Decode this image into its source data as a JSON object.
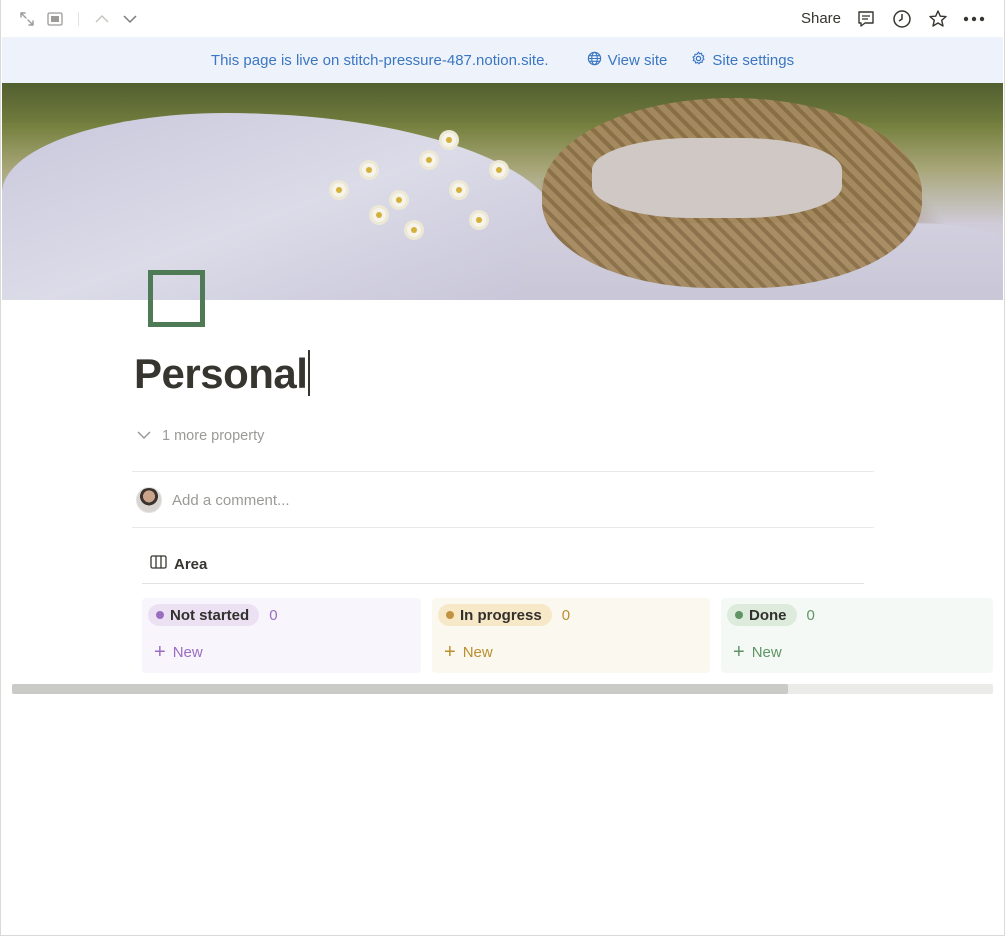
{
  "topbar": {
    "share_label": "Share",
    "left_icons": [
      "expand-icon",
      "peek-mode-icon",
      "chevron-up-icon",
      "chevron-down-icon"
    ],
    "right_icons": [
      "comment-icon",
      "history-icon",
      "star-icon",
      "more-icon"
    ]
  },
  "banner": {
    "message": "This page is live on stitch-pressure-487.notion.site.",
    "view_site": "View site",
    "site_settings": "Site settings",
    "color": "#3a76c2"
  },
  "page": {
    "title": "Personal",
    "more_property": "1 more property",
    "comment_placeholder": "Add a comment...",
    "icon_color": "#4f7a56"
  },
  "view": {
    "label": "Area",
    "icon": "board-icon"
  },
  "board": {
    "columns": [
      {
        "label": "Not started",
        "count": "0",
        "new_label": "New",
        "bg": "#f8f5fc",
        "pill_bg": "#ebe1f3",
        "dot": "#9a6dc1",
        "text": "#9a6dc1"
      },
      {
        "label": "In progress",
        "count": "0",
        "new_label": "New",
        "bg": "#fbf8ef",
        "pill_bg": "#f7e8c8",
        "dot": "#c29243",
        "text": "#b98f30"
      },
      {
        "label": "Done",
        "count": "0",
        "new_label": "New",
        "bg": "#f5f9f5",
        "pill_bg": "#dcebdc",
        "dot": "#5f9466",
        "text": "#5f9466"
      }
    ]
  }
}
